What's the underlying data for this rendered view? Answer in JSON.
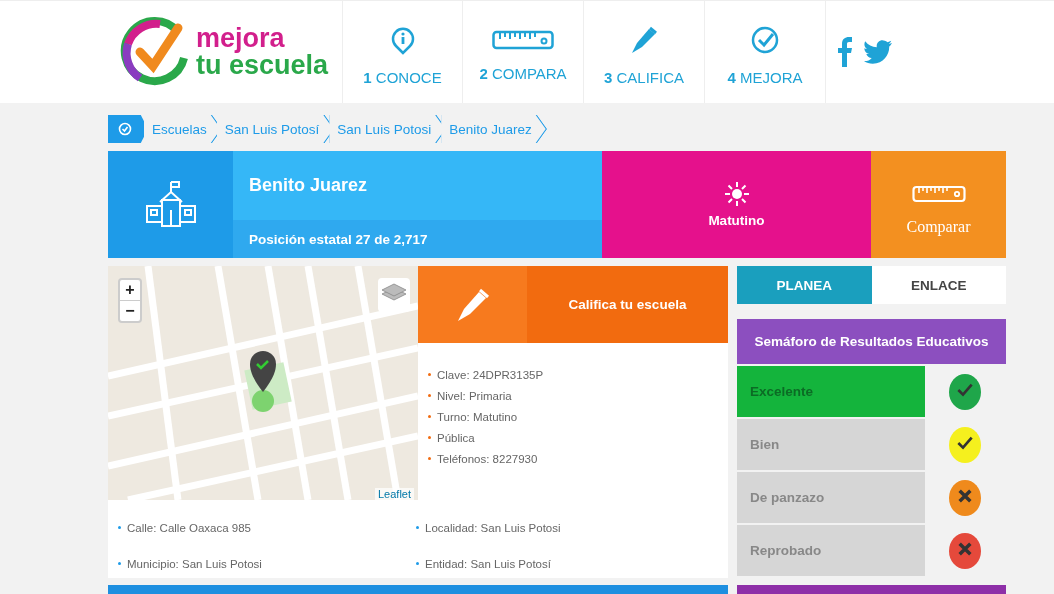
{
  "logo": {
    "line_1": "mejora",
    "line_2": "tu escuela"
  },
  "nav": [
    {
      "number": "1",
      "label": "CONOCE",
      "kind": "info"
    },
    {
      "number": "2",
      "label": "COMPARA",
      "kind": "ruler"
    },
    {
      "number": "3",
      "label": "CALIFICA",
      "kind": "pen"
    },
    {
      "number": "4",
      "label": "MEJORA",
      "kind": "check"
    }
  ],
  "breadcrumbs": [
    "Escuelas",
    "San Luis Potosí",
    "San Luis Potosi",
    "Benito Juarez"
  ],
  "school": {
    "name": "Benito Juarez",
    "position": "Posición estatal 27 de 2,717",
    "shift": "Matutino",
    "compare": "Comparar"
  },
  "map": {
    "zoom_in": "+",
    "zoom_out": "−",
    "attribution": "Leaflet"
  },
  "rate": {
    "label": "Califica tu escuela"
  },
  "details": [
    "Clave: 24DPR3135P",
    "Nivel: Primaria",
    "Turno: Matutino",
    "Pública",
    "Teléfonos: 8227930"
  ],
  "address": [
    "Calle: Calle Oaxaca 985",
    "Localidad: San Luis Potosi",
    "Municipio: San Luis Potosi",
    "Entidad: San Luis Potosí"
  ],
  "tabs": [
    {
      "label": "PLANEA",
      "selected": true
    },
    {
      "label": "ENLACE",
      "selected": false
    }
  ],
  "semaforo": {
    "title": "Semáforo de Resultados Educativos",
    "levels": [
      {
        "label": "Excelente",
        "selected": true,
        "color": "#1fa64a",
        "kind": "check"
      },
      {
        "label": "Bien",
        "selected": false,
        "color": "#f5f01e",
        "kind": "check"
      },
      {
        "label": "De panzazo",
        "selected": false,
        "color": "#ef8a1c",
        "kind": "cross"
      },
      {
        "label": "Reprobado",
        "selected": false,
        "color": "#e5493b",
        "kind": "cross"
      }
    ]
  }
}
